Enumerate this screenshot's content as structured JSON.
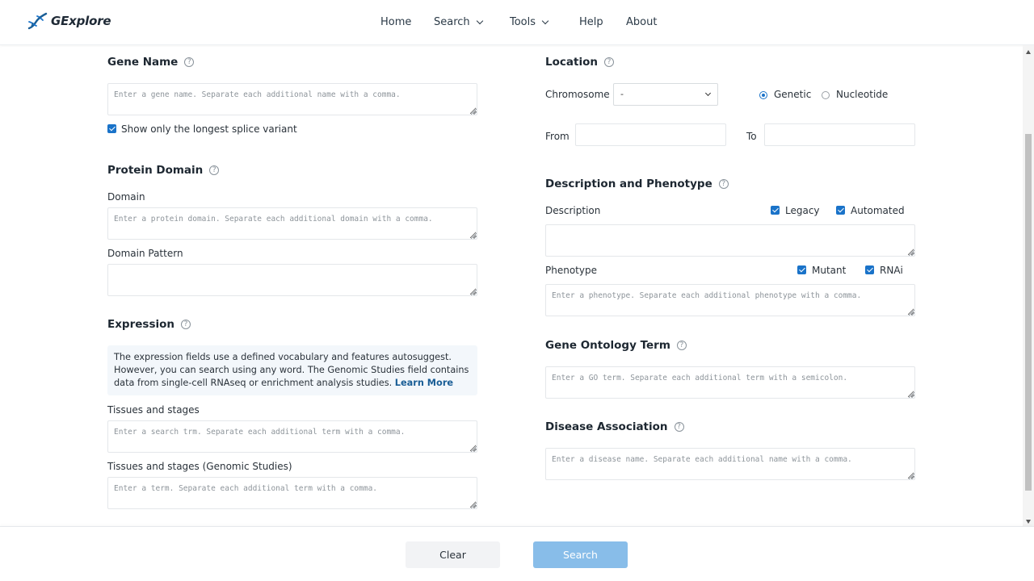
{
  "app": {
    "name": "GExplore"
  },
  "nav": {
    "home": "Home",
    "search": "Search",
    "tools": "Tools",
    "help": "Help",
    "about": "About"
  },
  "gene_name": {
    "title": "Gene Name",
    "placeholder": "Enter a gene name. Separate each additional name with a comma.",
    "longest_splice": "Show only the longest splice variant",
    "longest_splice_checked": true
  },
  "protein_domain": {
    "title": "Protein Domain",
    "domain_label": "Domain",
    "domain_placeholder": "Enter a protein domain. Separate each additional domain with a comma.",
    "pattern_label": "Domain Pattern",
    "pattern_placeholder": ""
  },
  "expression": {
    "title": "Expression",
    "info_text": "The expression fields use a defined vocabulary and features autosuggest. However, you can search using any word. The Genomic Studies field contains data from single-cell RNAseq or enrichment analysis studies.",
    "learn_more": "Learn More",
    "tissues_label": "Tissues and stages",
    "tissues_placeholder": "Enter a search trm. Separate each additional term with a comma.",
    "genomic_label": "Tissues and stages (Genomic Studies)",
    "genomic_placeholder": "Enter a term. Separate each additional term with a comma."
  },
  "location": {
    "title": "Location",
    "chromosome_label": "Chromosome",
    "chromosome_value": "-",
    "genetic_label": "Genetic",
    "nucleotide_label": "Nucleotide",
    "selected_mode": "Genetic",
    "from_label": "From",
    "to_label": "To"
  },
  "description_phenotype": {
    "title": "Description and Phenotype",
    "description_label": "Description",
    "legacy_label": "Legacy",
    "automated_label": "Automated",
    "description_placeholder": "",
    "phenotype_label": "Phenotype",
    "mutant_label": "Mutant",
    "rnai_label": "RNAi",
    "phenotype_placeholder": "Enter a phenotype. Separate each additional phenotype with a comma."
  },
  "go_term": {
    "title": "Gene Ontology Term",
    "placeholder": "Enter a GO term. Separate each additional term with a semicolon."
  },
  "disease": {
    "title": "Disease Association",
    "placeholder": "Enter a disease name. Separate each additional name with a comma."
  },
  "footer": {
    "clear": "Clear",
    "search": "Search"
  },
  "colors": {
    "accent": "#1a73c9",
    "search_button": "#88bde9",
    "info_box": "#f3f7fb"
  },
  "icons": {
    "logo": "dna-helix-icon",
    "help": "question-circle-icon",
    "dropdown": "chevron-down-icon"
  }
}
